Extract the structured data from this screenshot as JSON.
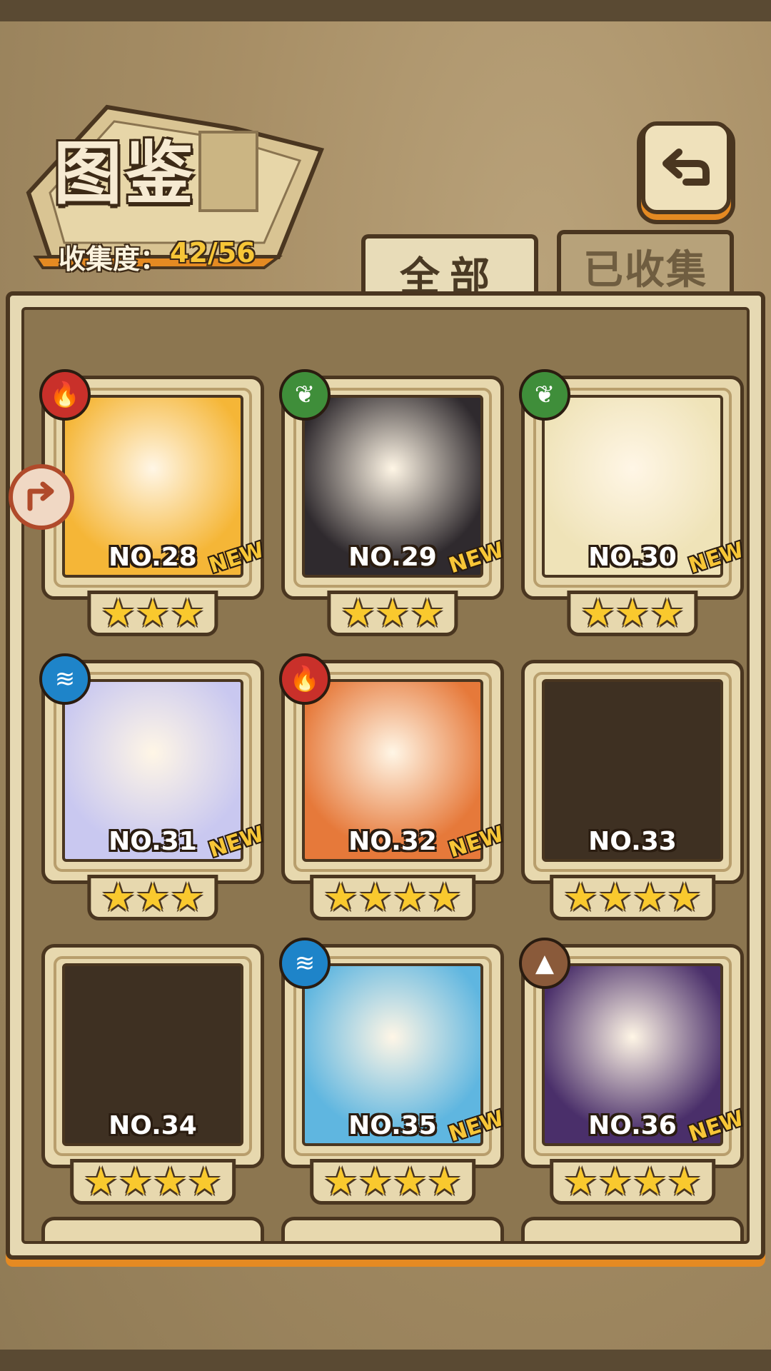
{
  "header": {
    "title": "图鉴",
    "collection_label": "收集度：",
    "collection_value": "42/56",
    "back_icon": "back-arrow-icon"
  },
  "tabs": [
    {
      "label": "全部",
      "selected": true
    },
    {
      "label": "已收集",
      "selected": false
    }
  ],
  "cards": [
    {
      "no": "NO.28",
      "stars": "★★★",
      "element": "fire",
      "new": "NEW",
      "locked": false,
      "color": "#f5b637"
    },
    {
      "no": "NO.29",
      "stars": "★★★",
      "element": "leaf",
      "new": "NEW",
      "locked": false,
      "color": "#2f2a2e"
    },
    {
      "no": "NO.30",
      "stars": "★★★",
      "element": "leaf",
      "new": "NEW",
      "locked": false,
      "color": "#efe3b8"
    },
    {
      "no": "NO.31",
      "stars": "★★★",
      "element": "water",
      "new": "NEW",
      "locked": false,
      "color": "#c9c8f0"
    },
    {
      "no": "NO.32",
      "stars": "★★★★",
      "element": "fire",
      "new": "NEW",
      "locked": false,
      "color": "#e6793a"
    },
    {
      "no": "NO.33",
      "stars": "★★★★",
      "element": "",
      "new": "",
      "locked": true,
      "color": "#3e3022"
    },
    {
      "no": "NO.34",
      "stars": "★★★★",
      "element": "",
      "new": "",
      "locked": true,
      "color": "#3e3022"
    },
    {
      "no": "NO.35",
      "stars": "★★★★",
      "element": "water",
      "new": "NEW",
      "locked": false,
      "color": "#5fb6e0"
    },
    {
      "no": "NO.36",
      "stars": "★★★★",
      "element": "earth",
      "new": "NEW",
      "locked": false,
      "color": "#4a2f6a"
    }
  ],
  "colors": {
    "fire": "#c9302a",
    "leaf": "#3f8e3a",
    "water": "#1e84c9",
    "earth": "#8a5a3a",
    "star": "#f9c92e",
    "accent": "#e58a22"
  }
}
